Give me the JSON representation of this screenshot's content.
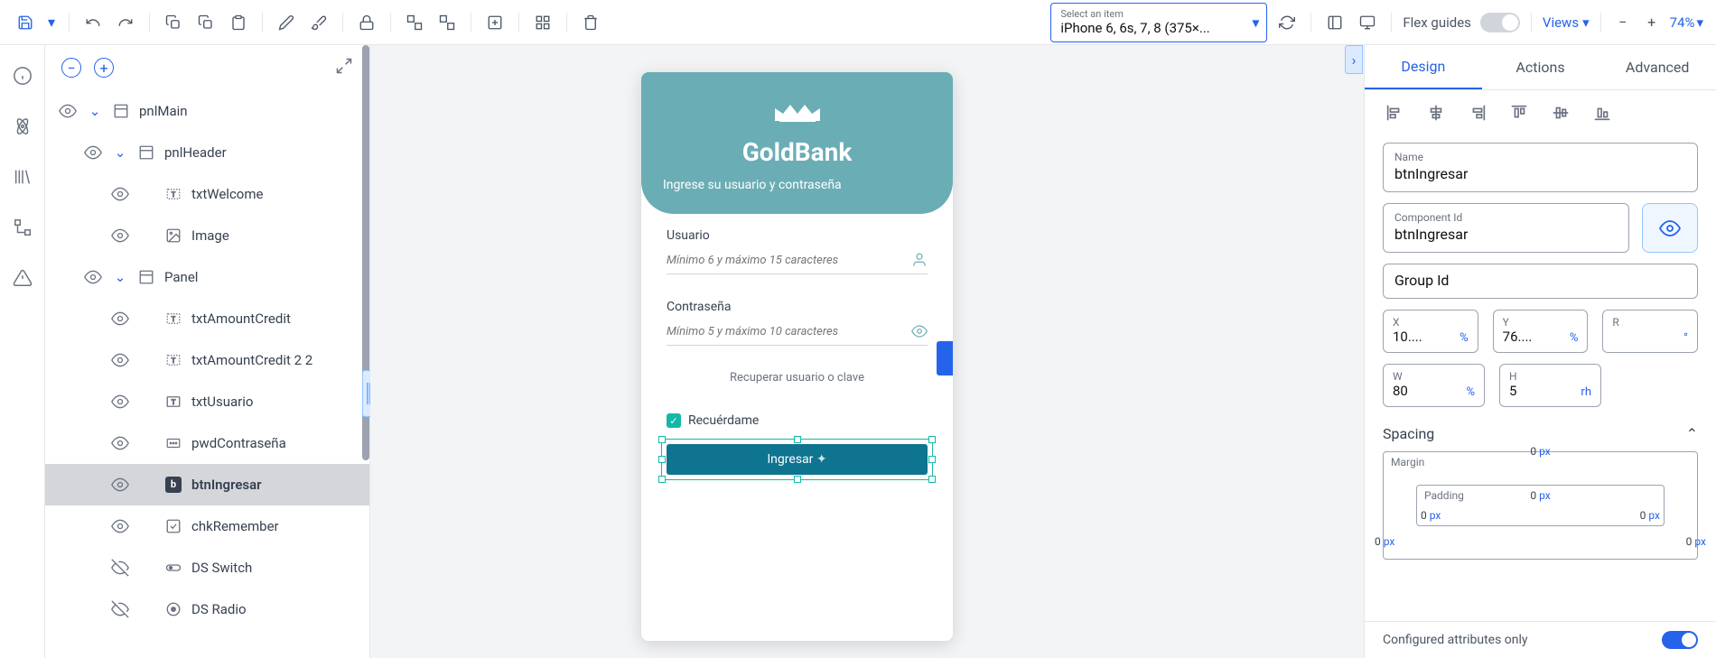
{
  "toolbar": {
    "device_label": "Select an item",
    "device_value": "iPhone 6, 6s, 7, 8 (375×...",
    "flex_guides": "Flex guides",
    "views": "Views",
    "zoom": "74%"
  },
  "outline": {
    "items": [
      {
        "name": "pnlMain",
        "type": "panel",
        "visible": true,
        "expanded": true,
        "depth": 1
      },
      {
        "name": "pnlHeader",
        "type": "panel",
        "visible": true,
        "expanded": true,
        "depth": 2
      },
      {
        "name": "txtWelcome",
        "type": "text-bound",
        "visible": true,
        "depth": 3
      },
      {
        "name": "Image",
        "type": "image",
        "visible": true,
        "depth": 3
      },
      {
        "name": "Panel",
        "type": "panel",
        "visible": true,
        "expanded": true,
        "depth": 2
      },
      {
        "name": "txtAmountCredit",
        "type": "text-bound",
        "visible": true,
        "depth": 3
      },
      {
        "name": "txtAmountCredit 2 2",
        "type": "text-bound",
        "visible": true,
        "depth": 3
      },
      {
        "name": "txtUsuario",
        "type": "text",
        "visible": true,
        "depth": 3
      },
      {
        "name": "pwdContraseña",
        "type": "password",
        "visible": true,
        "depth": 3
      },
      {
        "name": "btnIngresar",
        "type": "button",
        "visible": true,
        "depth": 3,
        "selected": true
      },
      {
        "name": "chkRemember",
        "type": "checkbox",
        "visible": true,
        "depth": 3
      },
      {
        "name": "DS Switch",
        "type": "switch",
        "visible": false,
        "depth": 3
      },
      {
        "name": "DS Radio",
        "type": "radio",
        "visible": false,
        "depth": 3
      }
    ]
  },
  "app": {
    "title": "GoldBank",
    "subtitle": "Ingrese su usuario y contraseña",
    "user_label": "Usuario",
    "user_placeholder": "Mínimo 6 y máximo 15 caracteres",
    "pass_label": "Contraseña",
    "pass_placeholder": "Mínimo 5 y máximo 10 caracteres",
    "recover": "Recuperar usuario o clave",
    "remember": "Recuérdame",
    "login": "Ingresar"
  },
  "props": {
    "tabs": [
      "Design",
      "Actions",
      "Advanced"
    ],
    "name_label": "Name",
    "name_value": "btnIngresar",
    "compid_label": "Component Id",
    "compid_value": "btnIngresar",
    "groupid_label": "Group Id",
    "groupid_value": "",
    "x_label": "X",
    "x_value": "10....",
    "x_unit": "%",
    "y_label": "Y",
    "y_value": "76....",
    "y_unit": "%",
    "r_label": "R",
    "r_value": "",
    "r_unit": "°",
    "w_label": "W",
    "w_value": "80",
    "w_unit": "%",
    "h_label": "H",
    "h_value": "5",
    "h_unit": "rh",
    "spacing_label": "Spacing",
    "margin_label": "Margin",
    "padding_label": "Padding",
    "margin_top": "0",
    "margin_top_unit": "px",
    "margin_left": "0",
    "margin_left_unit": "px",
    "margin_right": "0",
    "margin_right_unit": "px",
    "padding_top": "0",
    "padding_top_unit": "px",
    "padding_left": "0",
    "padding_left_unit": "px",
    "padding_right": "0",
    "padding_right_unit": "px",
    "config_only": "Configured attributes only"
  }
}
